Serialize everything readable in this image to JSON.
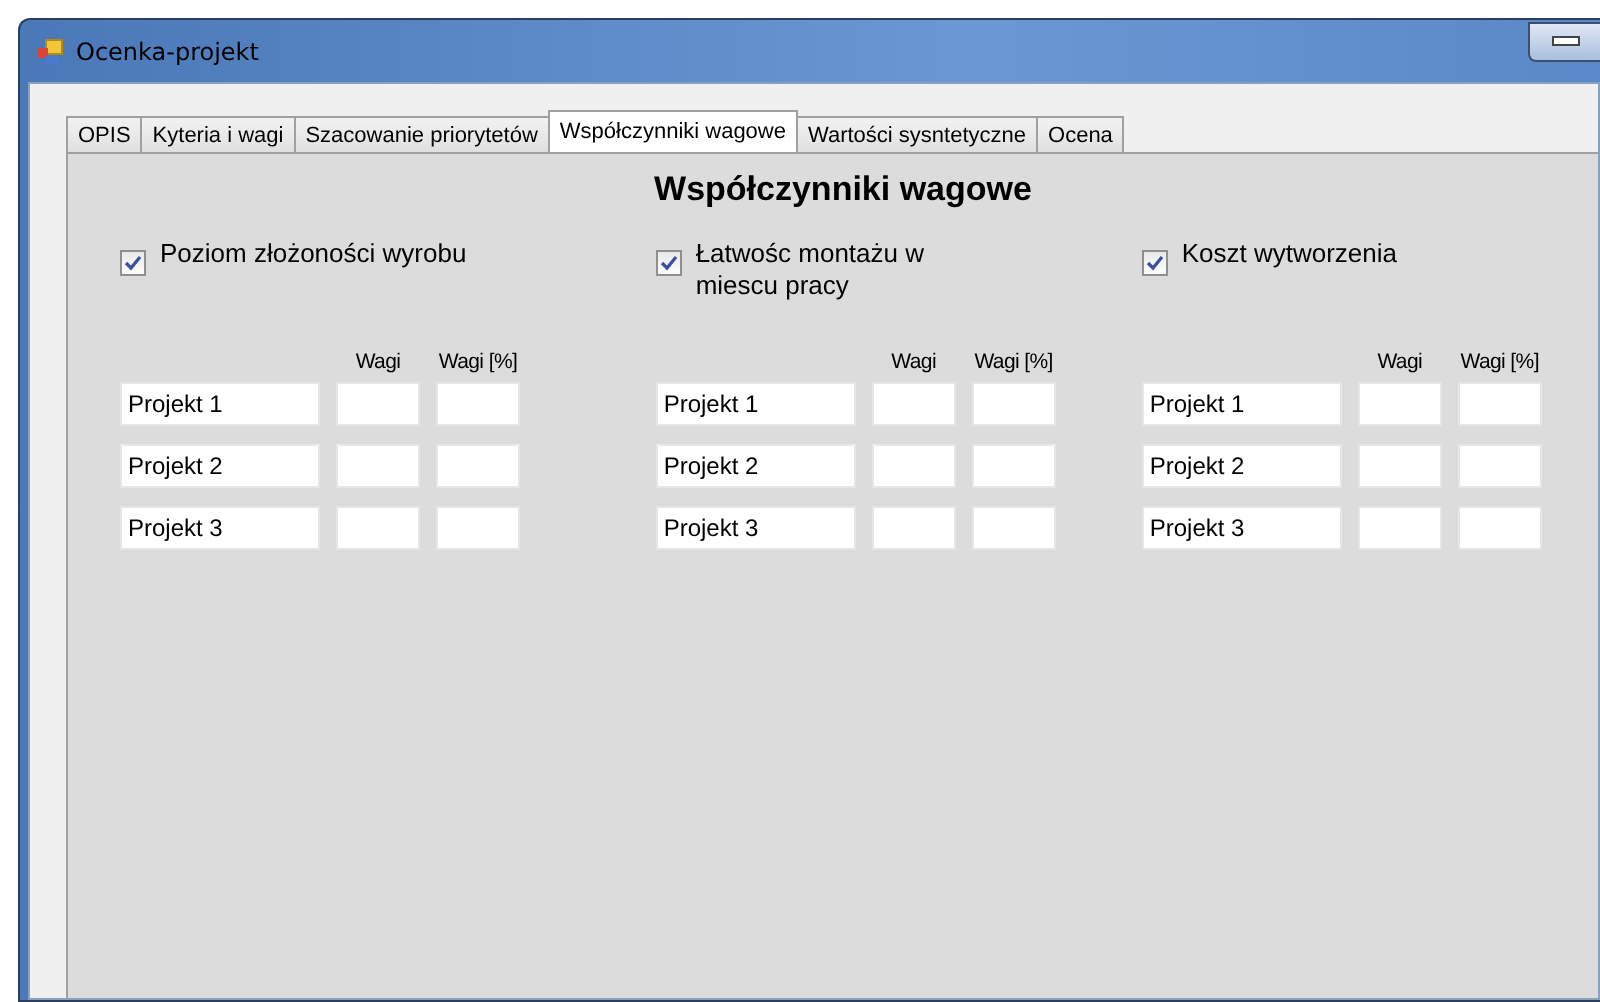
{
  "window": {
    "title": "Ocenka-projekt"
  },
  "tabs": [
    {
      "label": "OPIS",
      "selected": false
    },
    {
      "label": "Kyteria i wagi",
      "selected": false
    },
    {
      "label": "Szacowanie priorytetów",
      "selected": false
    },
    {
      "label": "Współczynniki wagowe",
      "selected": true
    },
    {
      "label": "Wartości sysntetyczne",
      "selected": false
    },
    {
      "label": "Ocena",
      "selected": false
    }
  ],
  "heading": "Współczynniki wagowe",
  "groups": [
    {
      "label": "Poziom złożoności wyrobu",
      "checked": true,
      "headers": [
        "Wagi",
        "Wagi [%]"
      ],
      "rows": [
        {
          "name": "Projekt 1"
        },
        {
          "name": "Projekt 2"
        },
        {
          "name": "Projekt 3"
        }
      ]
    },
    {
      "label": "Łatwośc montażu w miescu pracy",
      "checked": true,
      "headers": [
        "Wagi",
        "Wagi [%]"
      ],
      "rows": [
        {
          "name": "Projekt 1"
        },
        {
          "name": "Projekt 2"
        },
        {
          "name": "Projekt 3"
        }
      ]
    },
    {
      "label": "Koszt wytworzenia",
      "checked": true,
      "headers": [
        "Wagi",
        "Wagi [%]"
      ],
      "rows": [
        {
          "name": "Projekt 1"
        },
        {
          "name": "Projekt 2"
        },
        {
          "name": "Projekt 3"
        }
      ]
    }
  ]
}
